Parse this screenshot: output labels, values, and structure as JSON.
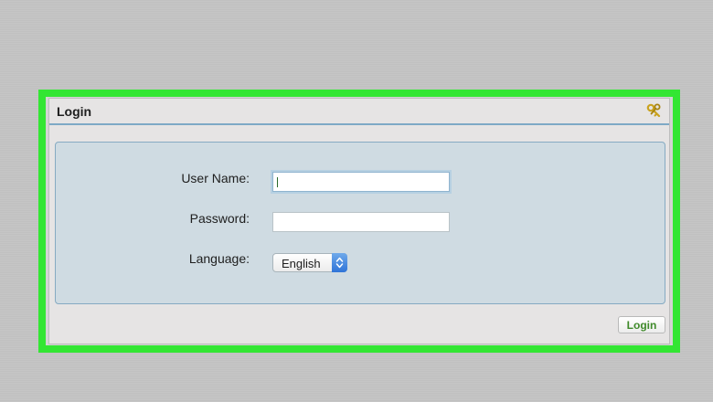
{
  "window": {
    "title": "Login"
  },
  "form": {
    "username": {
      "label": "User Name:",
      "value": ""
    },
    "password": {
      "label": "Password:",
      "value": ""
    },
    "language": {
      "label": "Language:",
      "selected": "English"
    }
  },
  "actions": {
    "login_label": "Login"
  },
  "icons": {
    "title_icon": "keys-icon",
    "select_arrows": "up-down-arrows-icon"
  },
  "colors": {
    "highlight_border": "#33e633",
    "title_rule": "#7ea9c6",
    "form_panel_bg": "#cfdbe2",
    "login_text": "#3f8a2a",
    "select_accent": "#2f74d8"
  }
}
